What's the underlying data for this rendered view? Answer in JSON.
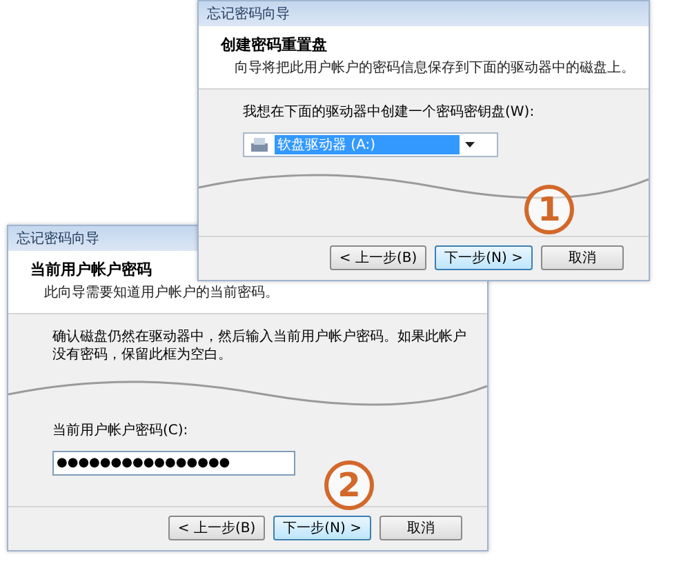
{
  "dialogs": [
    {
      "kind": "drive",
      "title": "忘记密码向导",
      "heading": "创建密码重置盘",
      "subtitle": "向导将把此用户帐户的密码信息保存到下面的驱动器中的磁盘上。",
      "prompt": "我想在下面的驱动器中创建一个密码密钥盘(W):",
      "drive": {
        "value": "软盘驱动器 (A:)"
      },
      "step_badge": "1",
      "buttons": [
        {
          "label": "< 上一步(B)",
          "focused": false
        },
        {
          "label": "下一步(N) >",
          "focused": true
        },
        {
          "label": "取消",
          "focused": false
        }
      ]
    },
    {
      "kind": "password",
      "title": "忘记密码向导",
      "heading": "当前用户帐户密码",
      "subtitle": "此向导需要知道用户帐户的当前密码。",
      "prompt": "确认磁盘仍然在驱动器中，然后输入当前用户帐户密码。如果此帐户没有密码，保留此框为空白。",
      "field_label": "当前用户帐户密码(C):",
      "password": {
        "value": "●●●●●●●●●●●●●●●●"
      },
      "step_badge": "2",
      "buttons": [
        {
          "label": "< 上一步(B)",
          "focused": false
        },
        {
          "label": "下一步(N) >",
          "focused": true
        },
        {
          "label": "取消",
          "focused": false
        }
      ]
    }
  ]
}
